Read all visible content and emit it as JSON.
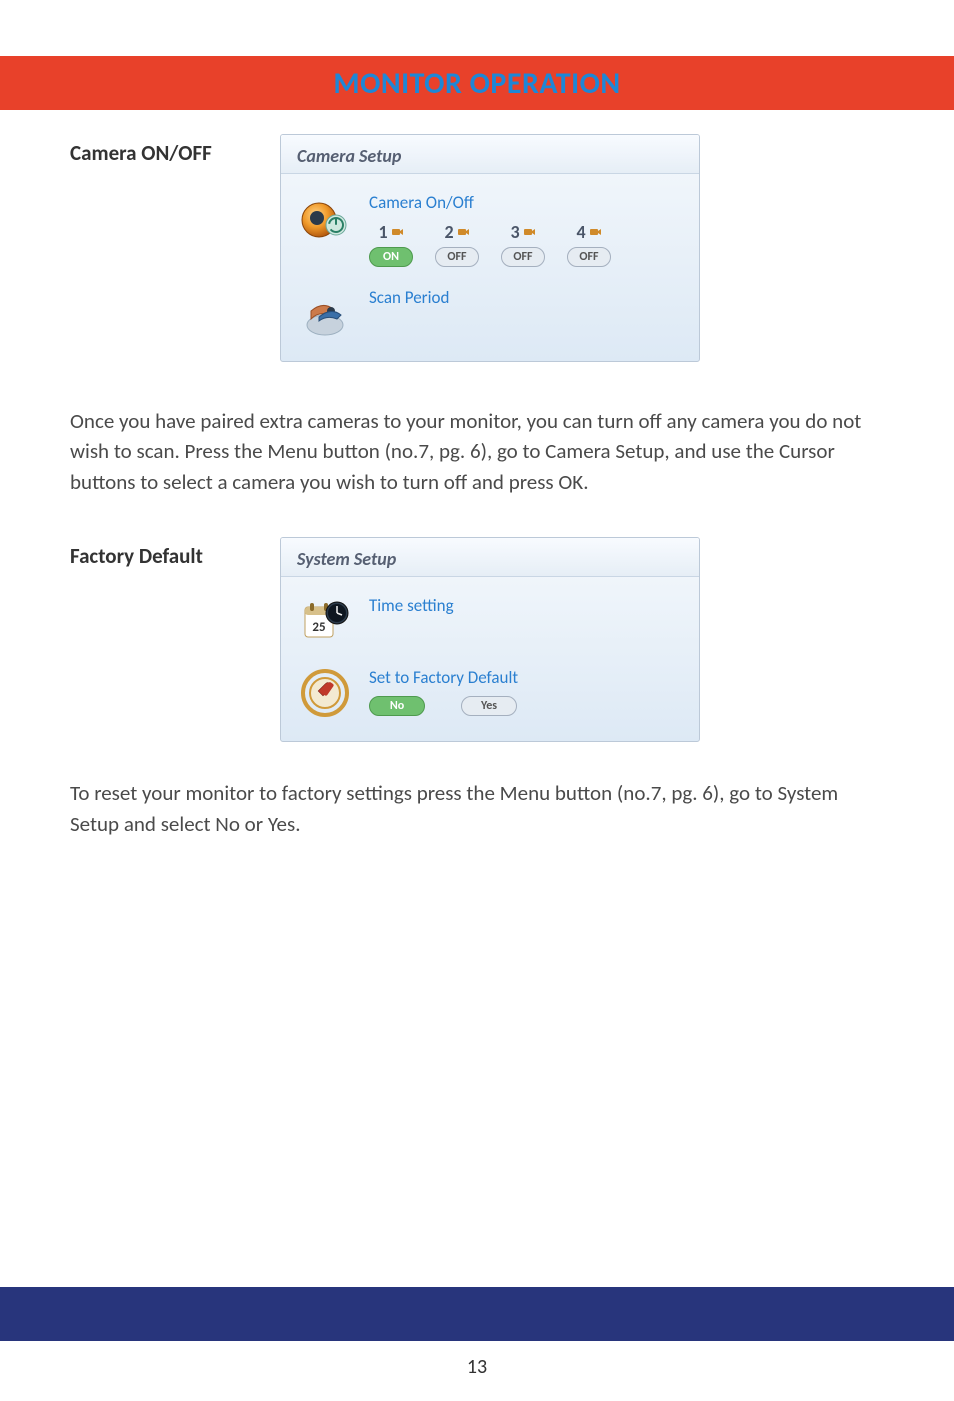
{
  "banner": {
    "title": "MONITOR OPERATION"
  },
  "section1": {
    "heading": "Camera ON/OFF",
    "panel_title": "Camera Setup",
    "camera_onoff_label": "Camera On/Off",
    "cameras": [
      {
        "num": "1",
        "state": "ON",
        "on": true
      },
      {
        "num": "2",
        "state": "OFF",
        "on": false
      },
      {
        "num": "3",
        "state": "OFF",
        "on": false
      },
      {
        "num": "4",
        "state": "OFF",
        "on": false
      }
    ],
    "scan_period_label": "Scan Period",
    "paragraph": "Once you have paired extra cameras to your monitor, you can turn off any camera you do not wish to scan. Press the Menu button (no.7, pg. 6), go to Camera Setup, and use the Cursor buttons to select a camera you wish to turn off and press OK."
  },
  "section2": {
    "heading": "Factory Default",
    "panel_title": "System Setup",
    "time_setting_label": "Time setting",
    "factory_default_label": "Set to Factory Default",
    "calendar_day": "25",
    "no_label": "No",
    "yes_label": "Yes",
    "paragraph": "To reset your monitor to factory settings press the Menu button (no.7, pg. 6), go to System Setup and select No or Yes."
  },
  "page_number": "13"
}
